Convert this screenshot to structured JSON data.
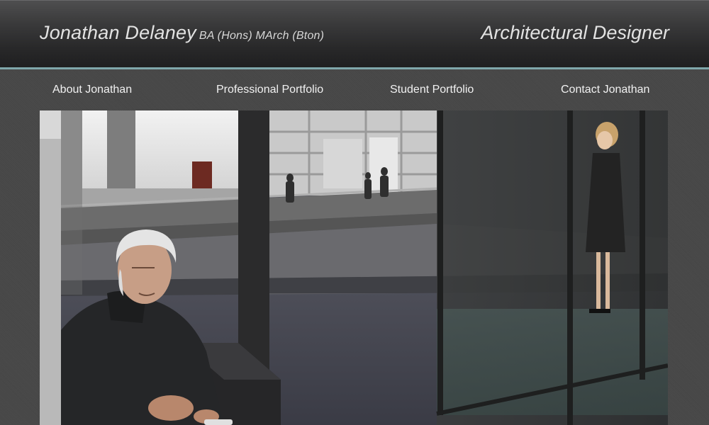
{
  "header": {
    "name": "Jonathan Delaney",
    "qualifications": "BA (Hons) MArch (Bton)",
    "role": "Architectural Designer",
    "accent_color": "#7fa7ab"
  },
  "nav": {
    "items": [
      {
        "label": "About Jonathan"
      },
      {
        "label": "Professional Portfolio"
      },
      {
        "label": "Student Portfolio"
      },
      {
        "label": "Contact Jonathan"
      }
    ]
  },
  "hero": {
    "subject": "architectural-rendering-image"
  }
}
